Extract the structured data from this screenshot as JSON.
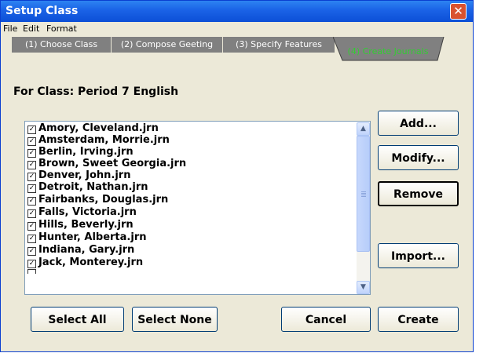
{
  "window": {
    "title": "Setup Class",
    "close_glyph": "✕"
  },
  "menu": [
    "File",
    "Edit",
    "Format"
  ],
  "tabs": [
    "(1) Choose Class",
    "(2) Compose Geeting",
    "(3) Specify Features",
    "(4) Create Journals"
  ],
  "class_label": "For Class:   Period 7 English",
  "journals": [
    "Amory, Cleveland.jrn",
    "Amsterdam, Morrie.jrn",
    "Berlin, Irving.jrn",
    "Brown, Sweet Georgia.jrn",
    "Denver, John.jrn",
    "Detroit, Nathan.jrn",
    "Fairbanks, Douglas.jrn",
    "Falls, Victoria.jrn",
    "Hills, Beverly.jrn",
    "Hunter, Alberta.jrn",
    "Indiana, Gary.jrn",
    "Jack, Monterey.jrn"
  ],
  "checkmark": "✓",
  "side_buttons": {
    "add": "Add...",
    "modify": "Modify...",
    "remove": "Remove",
    "import": "Import..."
  },
  "bottom_buttons": {
    "select_all": "Select All",
    "select_none": "Select None",
    "cancel": "Cancel",
    "create": "Create"
  },
  "colors": {
    "titlebar": "#0c4fd6",
    "active_tab_text": "#33cc33",
    "inactive_tab": "#808080",
    "dialog_bg": "#ece9d8"
  },
  "icons": {
    "scroll_up": "chevron-up-icon",
    "scroll_down": "chevron-down-icon",
    "close": "close-icon"
  }
}
